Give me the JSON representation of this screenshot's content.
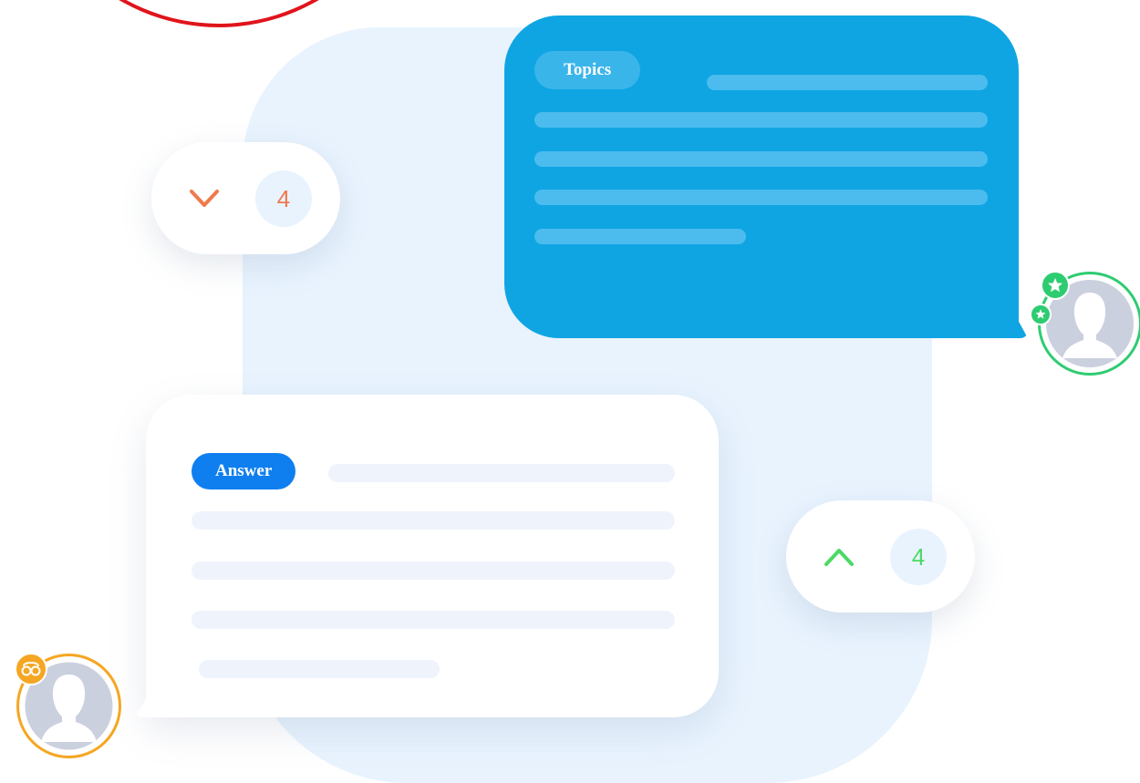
{
  "topics_card": {
    "label": "Topics"
  },
  "answer_card": {
    "label": "Answer"
  },
  "downvote": {
    "count": "4",
    "color": "#ef7a4b"
  },
  "upvote": {
    "count": "4",
    "color": "#4cd964"
  },
  "colors": {
    "topics_bubble": "#0fa5e3",
    "answer_pill": "#0f7ff0",
    "panel": "#e8f3fe",
    "avatar_ring_green": "#2ecc71",
    "avatar_ring_orange": "#f5a623"
  },
  "icons": {
    "downvote": "chevron-down-icon",
    "upvote": "chevron-up-icon",
    "author_badge": "star-icon",
    "answerer_badge": "glasses-icon"
  }
}
